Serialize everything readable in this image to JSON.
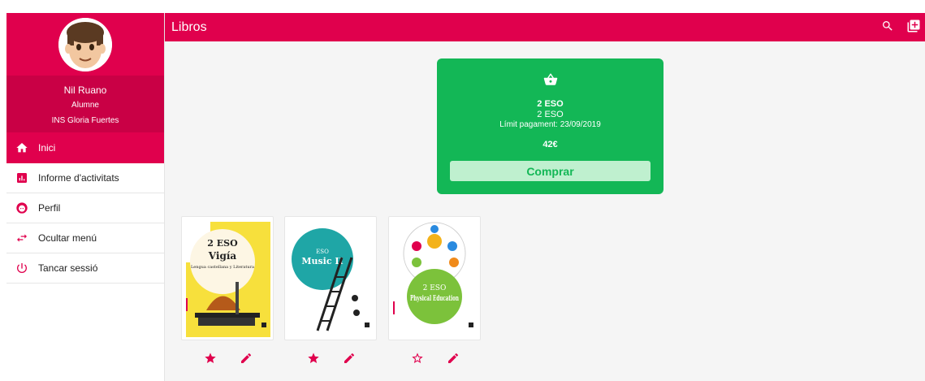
{
  "header": {
    "title": "Libros",
    "icons": [
      "search-icon",
      "add-box-icon"
    ]
  },
  "sidebar": {
    "user": {
      "name": "Nil Ruano",
      "role": "Alumne",
      "school": "INS Gloria Fuertes"
    },
    "items": [
      {
        "label": "Inici",
        "icon": "home-icon",
        "active": true
      },
      {
        "label": "Informe d'activitats",
        "icon": "bar-chart-icon",
        "active": false
      },
      {
        "label": "Perfil",
        "icon": "face-icon",
        "active": false
      },
      {
        "label": "Ocultar menú",
        "icon": "swap-arrows-icon",
        "active": false
      },
      {
        "label": "Tancar sessió",
        "icon": "power-icon",
        "active": false
      }
    ]
  },
  "purchase": {
    "title": "2 ESO",
    "subtitle": "2 ESO",
    "deadline": "Límit pagament: 23/09/2019",
    "price": "42€",
    "button": "Comprar",
    "icon": "basket-icon"
  },
  "books": [
    {
      "level": "2 ESO",
      "title": "Vigía",
      "subtitle": "Lengua castellana y Literatura",
      "favorite": true,
      "cover_color": "#f7e03c"
    },
    {
      "level": "ESO",
      "title": "Music II",
      "favorite": true,
      "cover_color": "#1fa6a6"
    },
    {
      "level": "2 ESO",
      "title": "Physical Education",
      "favorite": false,
      "cover_color": "#7cc23b"
    }
  ],
  "colors": {
    "brand": "#e0004d",
    "brand_dark": "#c90045",
    "success": "#13b756",
    "success_light": "#bff0cf"
  }
}
